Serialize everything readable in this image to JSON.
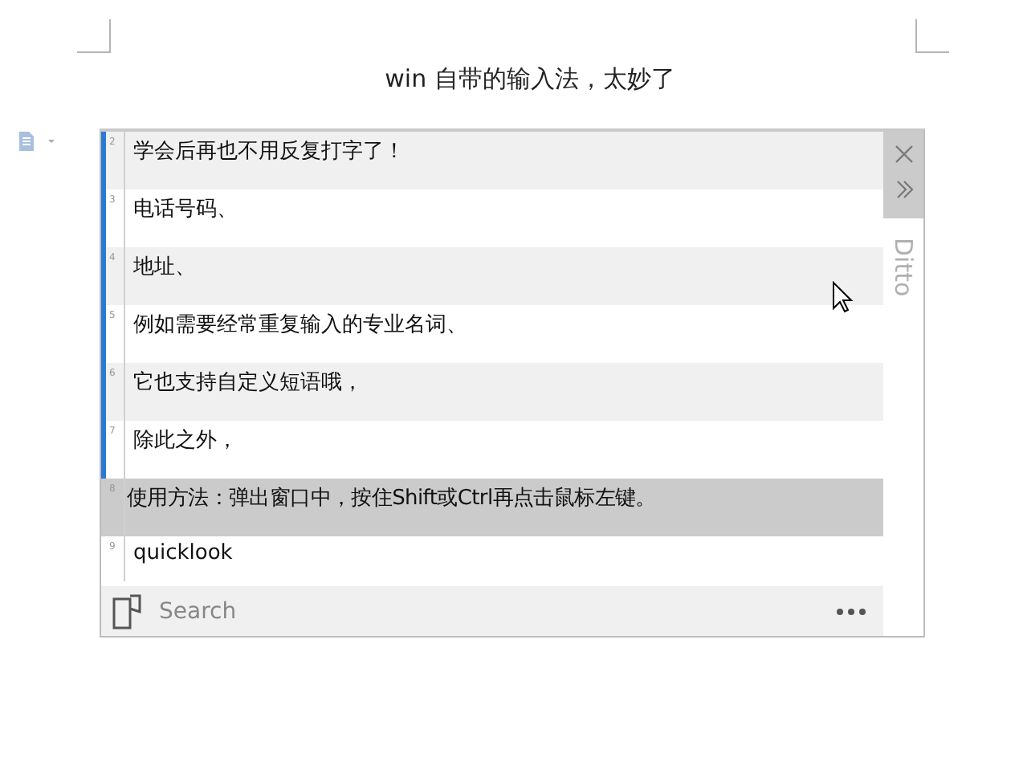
{
  "document": {
    "title": "win 自带的输入法，太妙了"
  },
  "clipboard_window": {
    "side_label": "Ditto",
    "rows": [
      {
        "number": "2",
        "text": "学会后再也不用反复打字了！",
        "selected": true,
        "highlighted": false
      },
      {
        "number": "3",
        "text": "电话号码、",
        "selected": true,
        "highlighted": false
      },
      {
        "number": "4",
        "text": "地址、",
        "selected": true,
        "highlighted": false
      },
      {
        "number": "5",
        "text": "例如需要经常重复输入的专业名词、",
        "selected": true,
        "highlighted": false
      },
      {
        "number": "6",
        "text": "它也支持自定义短语哦，",
        "selected": true,
        "highlighted": false
      },
      {
        "number": "7",
        "text": "除此之外，",
        "selected": true,
        "highlighted": false
      },
      {
        "number": "8",
        "text": "使用方法：弹出窗口中，按住Shift或Ctrl再点击鼠标左键。",
        "selected": false,
        "highlighted": true
      },
      {
        "number": "9",
        "text": "quicklook",
        "selected": false,
        "highlighted": false
      }
    ],
    "search": {
      "placeholder": "Search"
    }
  }
}
